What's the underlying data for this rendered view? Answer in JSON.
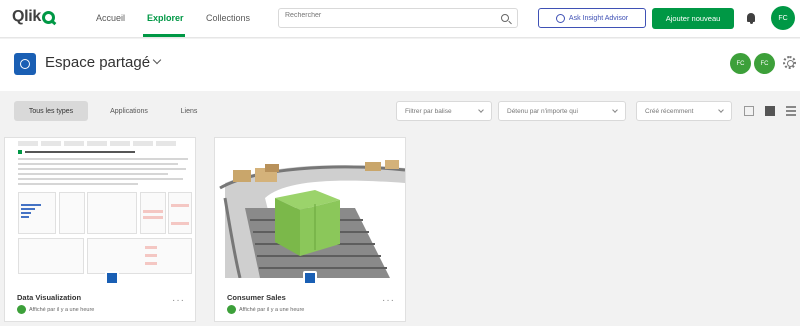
{
  "app": {
    "logo_text": "Qlik"
  },
  "nav": {
    "tabs": [
      {
        "label": "Accueil"
      },
      {
        "label": "Explorer"
      },
      {
        "label": "Collections"
      }
    ],
    "active_tab": "Explorer"
  },
  "search": {
    "placeholder": "Rechercher"
  },
  "header_actions": {
    "insight_label": "Ask Insight Advisor",
    "add_label": "Ajouter nouveau",
    "user_initials": "FC"
  },
  "space": {
    "title": "Espace partagé",
    "members": [
      "FC",
      "FC"
    ]
  },
  "filters": {
    "tabs": [
      {
        "label": "Tous les types"
      },
      {
        "label": "Applications"
      },
      {
        "label": "Liens"
      }
    ],
    "active_tab": "Tous les types",
    "dropdowns": [
      {
        "label": "Filtrer par balise"
      },
      {
        "label": "Détenu par n'importe qui"
      },
      {
        "label": "Créé récemment"
      }
    ]
  },
  "cards": [
    {
      "title": "Data Visualization",
      "subtitle": "Affiché par il y a une heure"
    },
    {
      "title": "Consumer Sales",
      "subtitle": "Affiché par il y a une heure"
    }
  ],
  "colors": {
    "accent": "#009845",
    "space": "#1a5fb4",
    "insight": "#3f51b5"
  }
}
